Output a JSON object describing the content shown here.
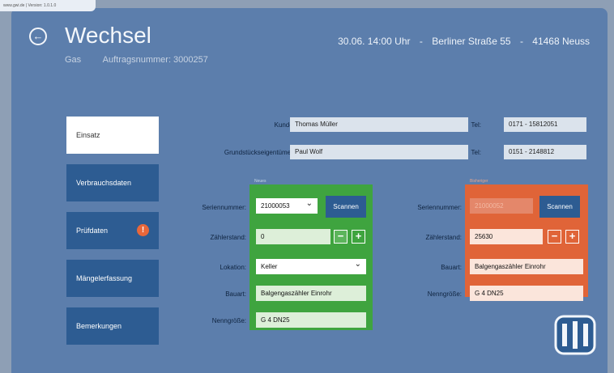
{
  "browser": {
    "url": "www.gwi.de | Version: 1.0.1.0"
  },
  "header": {
    "title": "Wechsel",
    "subtitle_type": "Gas",
    "subtitle_order": "Auftragsnummer: 3000257",
    "appointment_datetime": "30.06. 14:00 Uhr",
    "appointment_address": "Berliner Straße 55",
    "appointment_city": "41468 Neuss",
    "separator": "-"
  },
  "nav": {
    "items": [
      {
        "label": "Einsatz",
        "active": true
      },
      {
        "label": "Verbrauchsdaten",
        "active": false
      },
      {
        "label": "Prüfdaten",
        "active": false,
        "badge": "!"
      },
      {
        "label": "Mängelerfassung",
        "active": false
      },
      {
        "label": "Bemerkungen",
        "active": false
      }
    ]
  },
  "customer": {
    "kunde_label": "Kunde:",
    "kunde_value": "Thomas Müller",
    "owner_label": "Grundstückseigentümer:",
    "owner_value": "Paul Wolf",
    "tel_label": "Tel:",
    "kunde_tel": "0171 - 15812051",
    "owner_tel": "0151 - 2148812"
  },
  "new_meter": {
    "caption": "Neues",
    "serial_label": "Seriennummer:",
    "serial_value": "21000053",
    "scan_label": "Scannen",
    "reading_label": "Zählerstand:",
    "reading_value": "0",
    "location_label": "Lokation:",
    "location_value": "Keller",
    "type_label": "Bauart:",
    "type_value": "Balgengaszähler Einrohr",
    "size_label": "Nenngröße:",
    "size_value": "G 4 DN25"
  },
  "old_meter": {
    "caption": "Bisheriger",
    "serial_label": "Seriennummer:",
    "serial_value": "21000052",
    "scan_label": "Scannen",
    "reading_label": "Zählerstand:",
    "reading_value": "25630",
    "type_label": "Bauart:",
    "type_value": "Balgengaszähler Einrohr",
    "size_label": "Nenngröße:",
    "size_value": "G 4 DN25"
  },
  "stepper": {
    "minus": "−",
    "plus": "+"
  },
  "colors": {
    "background": "#5c7eac",
    "nav_button": "#2d5c92",
    "new_panel": "#3fa43f",
    "old_panel": "#e06438"
  }
}
